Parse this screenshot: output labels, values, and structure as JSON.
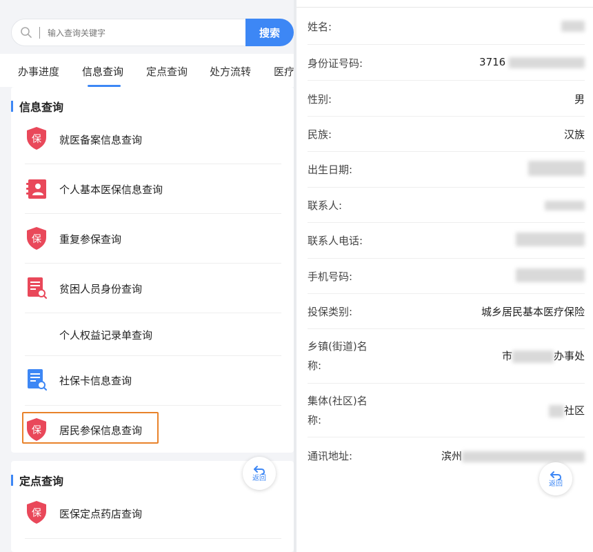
{
  "search": {
    "placeholder": "输入查询关键字",
    "button_label": "搜索"
  },
  "tabs": [
    {
      "label": "办事进度"
    },
    {
      "label": "信息查询",
      "active": true
    },
    {
      "label": "定点查询"
    },
    {
      "label": "处方流转"
    },
    {
      "label": "医疗"
    }
  ],
  "section_info": {
    "title": "信息查询",
    "items": [
      {
        "label": "就医备案信息查询",
        "icon": "shield-bao-icon"
      },
      {
        "label": "个人基本医保信息查询",
        "icon": "person-card-icon"
      },
      {
        "label": "重复参保查询",
        "icon": "shield-bao-icon"
      },
      {
        "label": "贫困人员身份查询",
        "icon": "document-search-icon"
      },
      {
        "label": "个人权益记录单查询",
        "icon": ""
      },
      {
        "label": "社保卡信息查询",
        "icon": "card-search-icon"
      },
      {
        "label": "居民参保信息查询",
        "icon": "shield-bao-icon",
        "highlighted": true
      }
    ]
  },
  "section_fixed": {
    "title": "定点查询",
    "items": [
      {
        "label": "医保定点药店查询",
        "icon": "shield-bao-icon"
      }
    ]
  },
  "back_button": {
    "label": "返回"
  },
  "icon_char": "保",
  "detail": {
    "rows": [
      {
        "label": "姓名:",
        "value_text": "",
        "value_suffix": ""
      },
      {
        "label": "身份证号码:",
        "value_text": "3716",
        "value_suffix": ""
      },
      {
        "label": "性别:",
        "value_text": "男",
        "value_suffix": ""
      },
      {
        "label": "民族:",
        "value_text": "汉族",
        "value_suffix": ""
      },
      {
        "label": "出生日期:",
        "value_text": "",
        "value_suffix": ""
      },
      {
        "label": "联系人:",
        "value_text": "",
        "value_suffix": ""
      },
      {
        "label": "联系人电话:",
        "value_text": "",
        "value_suffix": ""
      },
      {
        "label": "手机号码:",
        "value_text": "",
        "value_suffix": ""
      },
      {
        "label": "投保类别:",
        "value_text": "城乡居民基本医疗保险",
        "value_suffix": ""
      },
      {
        "label_line1": "乡镇(街道)名",
        "label_line2": "称:",
        "value_text": "市",
        "value_suffix": "办事处"
      },
      {
        "label_line1": "集体(社区)名",
        "label_line2": "称:",
        "value_text": "",
        "value_suffix": "社区"
      },
      {
        "label": "通讯地址:",
        "value_text": "滨州",
        "value_suffix": ""
      }
    ]
  },
  "colors": {
    "accent": "#3d87f5",
    "icon_red": "#e9485a",
    "highlight": "#e8822a"
  }
}
